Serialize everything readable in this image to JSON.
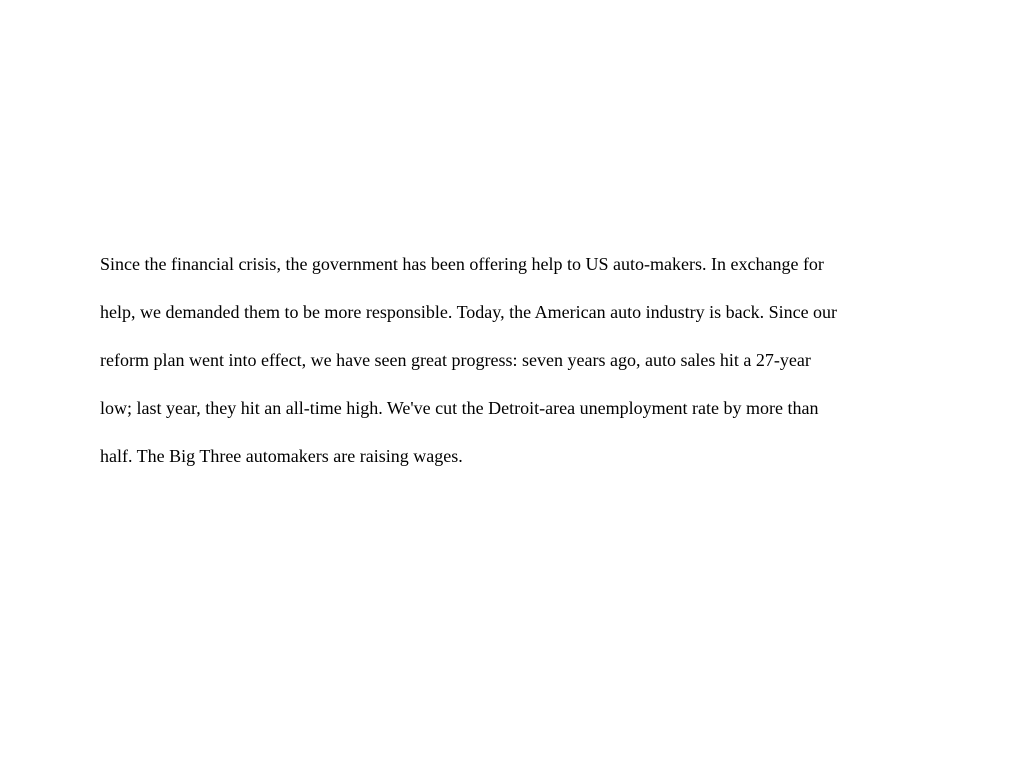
{
  "document": {
    "lines": [
      "Since the financial crisis, the government has been offering help to US auto-makers. In exchange for",
      "help, we demanded them to be more responsible. Today, the American auto industry is back. Since our",
      "reform plan went into effect, we have seen great progress: seven years ago, auto sales hit a 27-year",
      "low; last year, they hit an all-time high. We've cut the Detroit-area unemployment rate by more than",
      "half. The Big Three automakers are raising wages."
    ]
  }
}
